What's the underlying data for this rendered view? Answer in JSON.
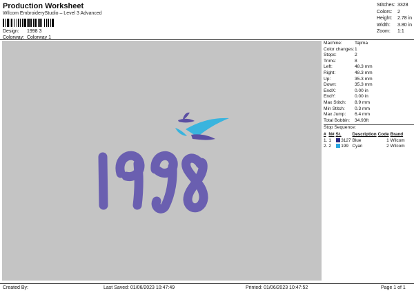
{
  "header": {
    "title": "Production Worksheet",
    "subtitle": "Wilcom EmbroideryStudio – Level 3 Advanced",
    "design_label": "Design:",
    "design_value": "1998 3",
    "colorway_label": "Colorway:",
    "colorway_value": "Colorway 1"
  },
  "stats": [
    {
      "k": "Stitches:",
      "v": "3328"
    },
    {
      "k": "Colors:",
      "v": "2"
    },
    {
      "k": "Height:",
      "v": "2.78 in"
    },
    {
      "k": "Width:",
      "v": "3.80 in"
    },
    {
      "k": "Zoom:",
      "v": "1:1"
    }
  ],
  "machine_info": [
    {
      "k": "Machine:",
      "v": "Tajima"
    },
    {
      "k": "Color changes:",
      "v": "1"
    },
    {
      "k": "Stops:",
      "v": "2"
    },
    {
      "k": "Trims:",
      "v": "8"
    },
    {
      "k": "Left:",
      "v": "48.3 mm"
    },
    {
      "k": "Right:",
      "v": "48.3 mm"
    },
    {
      "k": "Up:",
      "v": "35.3 mm"
    },
    {
      "k": "Down:",
      "v": "35.3 mm"
    },
    {
      "k": "EndX:",
      "v": "0.00 in"
    },
    {
      "k": "EndY:",
      "v": "0.00 in"
    },
    {
      "k": "Max Stitch:",
      "v": "8.9 mm"
    },
    {
      "k": "Min Stitch:",
      "v": "0.3 mm"
    },
    {
      "k": "Max Jump:",
      "v": "6.4 mm"
    },
    {
      "k": "Total Bobbin:",
      "v": "34.93ft"
    }
  ],
  "stop_sequence": {
    "title": "Stop Sequence:",
    "headers": [
      "#",
      "N#",
      "St.",
      "Description",
      "Code",
      "Brand"
    ],
    "rows": [
      {
        "num": "1.",
        "n": "1",
        "color": "#2e2a80",
        "st": "3127",
        "desc": "Blue",
        "code": "1",
        "brand": "Wilcom"
      },
      {
        "num": "2.",
        "n": "2",
        "color": "#2aa6e0",
        "st": "199",
        "desc": "Cyan",
        "code": "2",
        "brand": "Wilcom"
      }
    ]
  },
  "design_colors": {
    "digits": "#6a5fb0",
    "birds_body": "#5b4fa3",
    "birds_wing": "#39b4de"
  },
  "design_text": "1998",
  "footer": {
    "created_by": "Created By:",
    "last_saved": "Last Saved: 01/06/2023 10:47:49",
    "printed": "Printed: 01/06/2023 10:47:52",
    "page": "Page 1 of 1"
  }
}
